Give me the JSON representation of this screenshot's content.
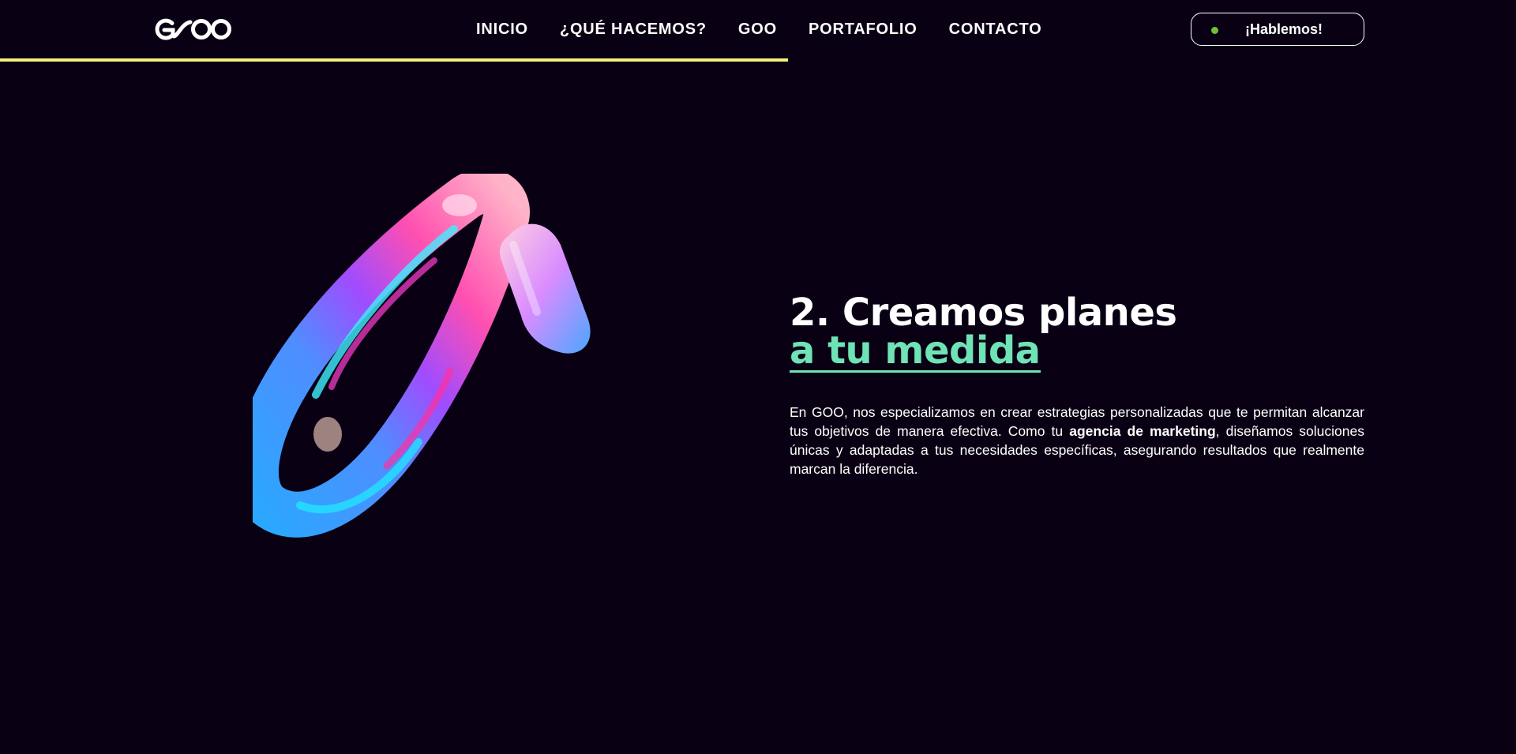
{
  "brand": {
    "logo_text": "GOO"
  },
  "nav": {
    "items": [
      {
        "label": "INICIO"
      },
      {
        "label": "¿QUÉ HACEMOS?"
      },
      {
        "label": "GOO"
      },
      {
        "label": "PORTAFOLIO"
      },
      {
        "label": "CONTACTO"
      }
    ]
  },
  "cta": {
    "label": "¡Hablemos!",
    "status_color": "#6fbf3a"
  },
  "scroll_progress": 0.52,
  "section": {
    "title_line1": "2. Creamos planes",
    "title_line2": "a tu medida",
    "body_part1": "En GOO, nos especializamos en crear estrategias personalizadas que te permitan alcanzar tus objetivos de manera efectiva. Como tu ",
    "body_bold": "agencia de marketing",
    "body_part2": ", diseñamos soluciones únicas y adaptadas a tus necesidades específicas, asegurando resultados que realmente marcan la diferencia."
  },
  "colors": {
    "background": "#0a0014",
    "accent_green": "#6fe3b6",
    "progress_yellow": "#f6ef7c"
  },
  "icons": {
    "hero": "3d-iridescent-loop-shape"
  }
}
